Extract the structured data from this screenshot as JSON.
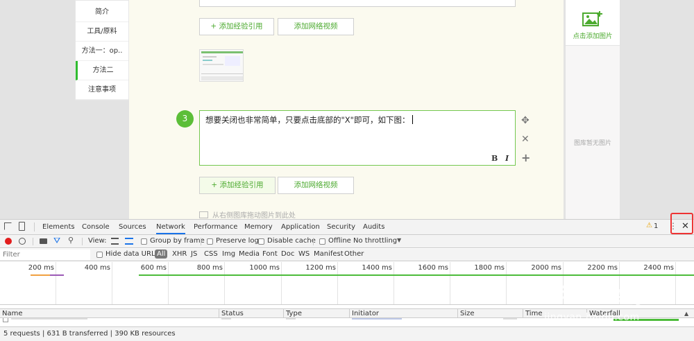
{
  "left_nav": {
    "items": [
      {
        "label": "简介"
      },
      {
        "label": "工具/原料"
      },
      {
        "label": "方法一：op.."
      },
      {
        "label": "方法二"
      },
      {
        "label": "注意事项"
      }
    ]
  },
  "editor": {
    "add_reference_label": "+ 添加经验引用",
    "add_video_label": "添加网络视频",
    "step_number": "3",
    "step_text": "想要关闭也非常简单，只要点击底部的\"X\"即可，如下图：",
    "bold_label": "B",
    "italic_label": "I",
    "drag_hint": "从右侧图库拖动图片到此处"
  },
  "right_panel": {
    "add_image_label": "点击添加图片",
    "empty_label": "图库暂无图片"
  },
  "devtools": {
    "tabs": [
      "Elements",
      "Console",
      "Sources",
      "Network",
      "Performance",
      "Memory",
      "Application",
      "Security",
      "Audits"
    ],
    "active_tab": "Network",
    "warning_count": "1",
    "toolbar": {
      "view_label": "View:",
      "group_by_frame": "Group by frame",
      "preserve_log": "Preserve log",
      "disable_cache": "Disable cache",
      "offline": "Offline",
      "throttling": "No throttling"
    },
    "filter": {
      "placeholder": "Filter",
      "hide_data_urls": "Hide data URLs",
      "types": [
        "All",
        "XHR",
        "JS",
        "CSS",
        "Img",
        "Media",
        "Font",
        "Doc",
        "WS",
        "Manifest",
        "Other"
      ]
    },
    "timeline_ticks": [
      "200 ms",
      "400 ms",
      "600 ms",
      "800 ms",
      "1000 ms",
      "1200 ms",
      "1400 ms",
      "1600 ms",
      "1800 ms",
      "2000 ms",
      "2200 ms",
      "2400 ms"
    ],
    "columns": [
      "Name",
      "Status",
      "Type",
      "Initiator",
      "Size",
      "Time",
      "Waterfall"
    ],
    "status": "5 requests | 631 B transferred | 390 KB resources"
  },
  "colors": {
    "accent_green": "#5cbe38",
    "highlight_red": "#e33333",
    "devtools_blue": "#1a73e8"
  },
  "watermark": {
    "brand": "Bai",
    "brand_cn": "经验",
    "url": "jingyan.baidu.com"
  }
}
